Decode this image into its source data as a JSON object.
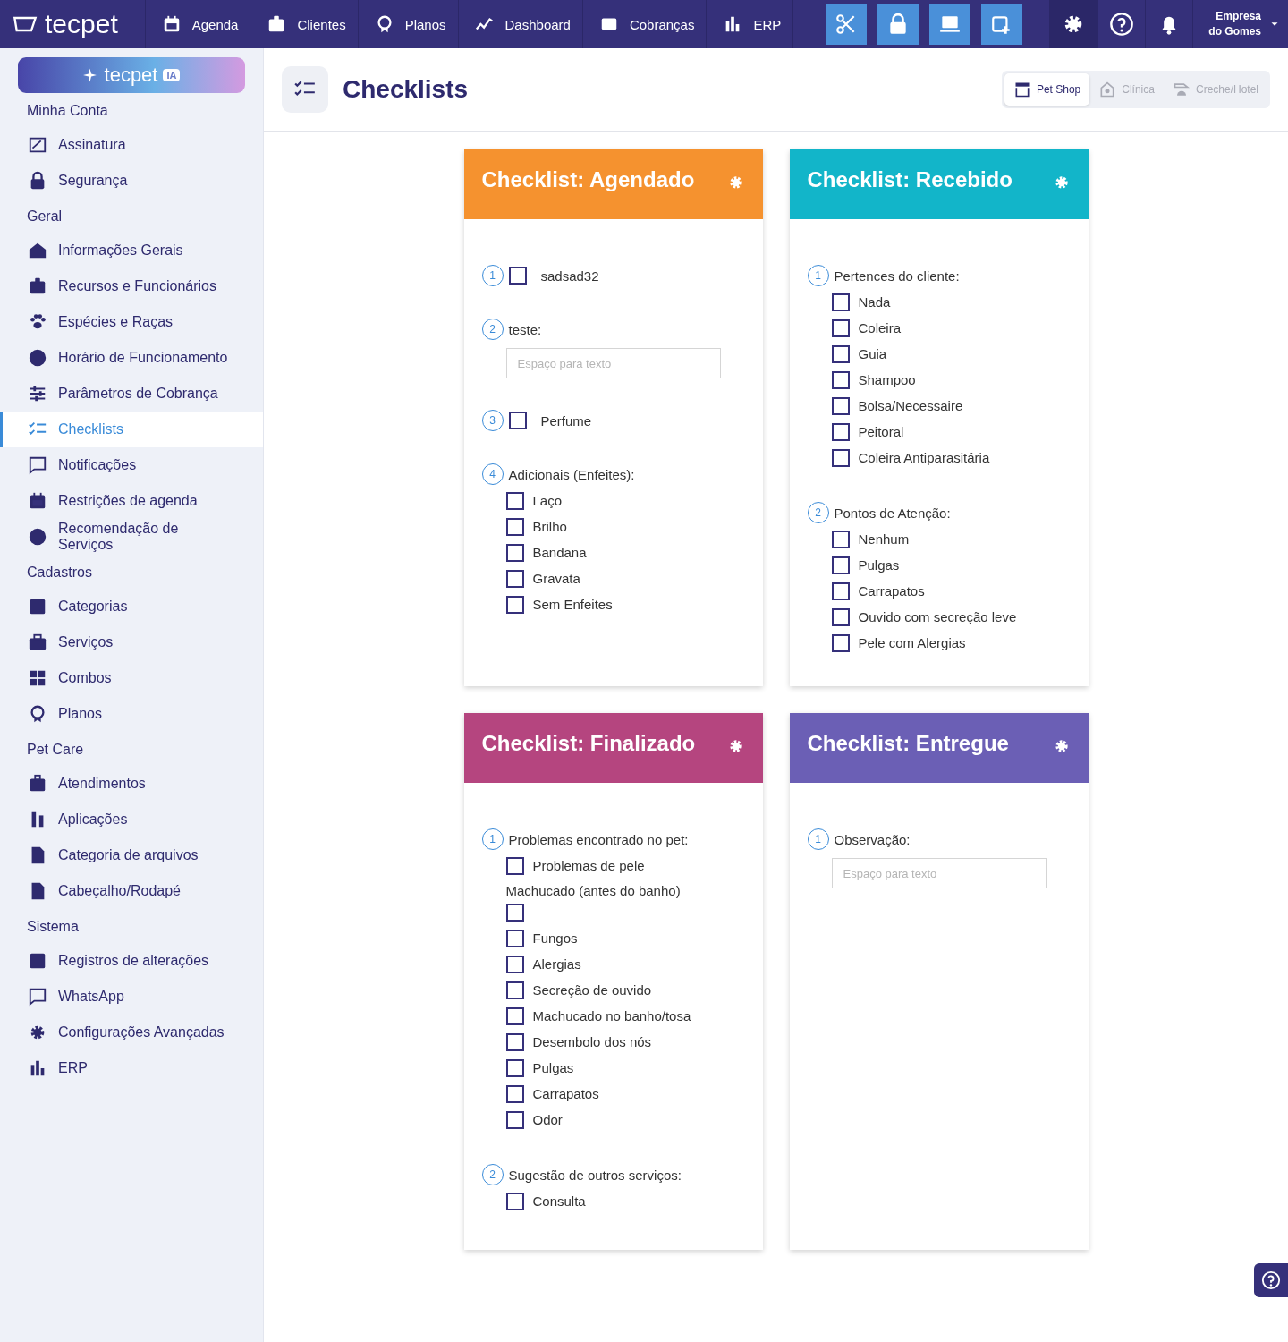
{
  "topbar": {
    "logo": "tecpet",
    "nav": [
      {
        "label": "Agenda"
      },
      {
        "label": "Clientes"
      },
      {
        "label": "Planos"
      },
      {
        "label": "Dashboard"
      },
      {
        "label": "Cobranças"
      },
      {
        "label": "ERP"
      }
    ],
    "company": "Empresa do Gomes"
  },
  "sidebar": {
    "ai_banner": {
      "logo": "tecpet",
      "badge": "IA"
    },
    "sections": [
      {
        "title": "Minha Conta",
        "items": [
          {
            "label": "Assinatura",
            "selected": false
          },
          {
            "label": "Segurança",
            "selected": false
          }
        ]
      },
      {
        "title": "Geral",
        "items": [
          {
            "label": "Informações Gerais",
            "selected": false
          },
          {
            "label": "Recursos e Funcionários",
            "selected": false
          },
          {
            "label": "Espécies e Raças",
            "selected": false
          },
          {
            "label": "Horário de Funcionamento",
            "selected": false
          },
          {
            "label": "Parâmetros de Cobrança",
            "selected": false
          },
          {
            "label": "Checklists",
            "selected": true
          },
          {
            "label": "Notificações",
            "selected": false
          },
          {
            "label": "Restrições de agenda",
            "selected": false
          },
          {
            "label": "Recomendação de Serviços",
            "selected": false
          }
        ]
      },
      {
        "title": "Cadastros",
        "items": [
          {
            "label": "Categorias",
            "selected": false
          },
          {
            "label": "Serviços",
            "selected": false
          },
          {
            "label": "Combos",
            "selected": false
          },
          {
            "label": "Planos",
            "selected": false
          }
        ]
      },
      {
        "title": "Pet Care",
        "items": [
          {
            "label": "Atendimentos",
            "selected": false
          },
          {
            "label": "Aplicações",
            "selected": false
          },
          {
            "label": "Categoria de arquivos",
            "selected": false
          },
          {
            "label": "Cabeçalho/Rodapé",
            "selected": false
          }
        ]
      },
      {
        "title": "Sistema",
        "items": [
          {
            "label": "Registros de alterações",
            "selected": false
          },
          {
            "label": "WhatsApp",
            "selected": false
          },
          {
            "label": "Configurações Avançadas",
            "selected": false
          },
          {
            "label": "ERP",
            "selected": false
          }
        ]
      }
    ]
  },
  "header": {
    "title": "Checklists",
    "segments": [
      {
        "label": "Pet Shop",
        "selected": true
      },
      {
        "label": "Clínica",
        "selected": false
      },
      {
        "label": "Creche/Hotel",
        "selected": false
      }
    ]
  },
  "checklists": [
    {
      "title": "Checklist: Agendado",
      "color": "#f5922f",
      "questions": [
        {
          "number": "1",
          "kind": "check",
          "label": "sadsad32",
          "checked": false
        },
        {
          "number": "2",
          "kind": "text",
          "label": "teste:",
          "placeholder": "Espaço para texto"
        },
        {
          "number": "3",
          "kind": "check",
          "label": "Perfume",
          "checked": false
        },
        {
          "number": "4",
          "kind": "options",
          "label": "Adicionais (Enfeites):",
          "options": [
            {
              "label": "Laço",
              "checked": false,
              "kind": "inline"
            },
            {
              "label": "Brilho",
              "checked": false,
              "kind": "inline"
            },
            {
              "label": "Bandana",
              "checked": false,
              "kind": "inline"
            },
            {
              "label": "Gravata",
              "checked": false,
              "kind": "inline"
            },
            {
              "label": "Sem Enfeites",
              "checked": false,
              "kind": "inline"
            }
          ]
        }
      ]
    },
    {
      "title": "Checklist: Recebido",
      "color": "#12b5c9",
      "questions": [
        {
          "number": "1",
          "kind": "options",
          "label": "Pertences do cliente:",
          "options": [
            {
              "label": "Nada",
              "checked": false,
              "kind": "inline"
            },
            {
              "label": "Coleira",
              "checked": false,
              "kind": "inline"
            },
            {
              "label": "Guia",
              "checked": false,
              "kind": "inline"
            },
            {
              "label": "Shampoo",
              "checked": false,
              "kind": "inline"
            },
            {
              "label": "Bolsa/Necessaire",
              "checked": false,
              "kind": "inline"
            },
            {
              "label": "Peitoral",
              "checked": false,
              "kind": "inline"
            },
            {
              "label": "Coleira Antiparasitária",
              "checked": false,
              "kind": "inline"
            }
          ]
        },
        {
          "number": "2",
          "kind": "options",
          "label": "Pontos de Atenção:",
          "options": [
            {
              "label": "Nenhum",
              "checked": false,
              "kind": "inline"
            },
            {
              "label": "Pulgas",
              "checked": false,
              "kind": "inline"
            },
            {
              "label": "Carrapatos",
              "checked": false,
              "kind": "inline"
            },
            {
              "label": "Ouvido com secreção leve",
              "checked": false,
              "kind": "inline"
            },
            {
              "label": "Pele com Alergias",
              "checked": false,
              "kind": "inline"
            }
          ]
        }
      ]
    },
    {
      "title": "Checklist: Finalizado",
      "color": "#b5457f",
      "questions": [
        {
          "number": "1",
          "kind": "options",
          "label": "Problemas encontrado no pet:",
          "options": [
            {
              "label": "Problemas de pele",
              "checked": false,
              "kind": "inline"
            },
            {
              "label": "Machucado (antes do banho)",
              "checked": false,
              "kind": "stacked"
            },
            {
              "label": "Fungos",
              "checked": false,
              "kind": "inline"
            },
            {
              "label": "Alergias",
              "checked": false,
              "kind": "inline"
            },
            {
              "label": "Secreção de ouvido",
              "checked": false,
              "kind": "inline"
            },
            {
              "label": "Machucado no banho/tosa",
              "checked": false,
              "kind": "inline"
            },
            {
              "label": "Desembolo dos nós",
              "checked": false,
              "kind": "inline"
            },
            {
              "label": "Pulgas",
              "checked": false,
              "kind": "inline"
            },
            {
              "label": "Carrapatos",
              "checked": false,
              "kind": "inline"
            },
            {
              "label": "Odor",
              "checked": false,
              "kind": "inline"
            }
          ]
        },
        {
          "number": "2",
          "kind": "options",
          "label": "Sugestão de outros serviços:",
          "options": [
            {
              "label": "Consulta",
              "checked": false,
              "kind": "inline"
            }
          ]
        }
      ]
    },
    {
      "title": "Checklist: Entregue",
      "color": "#6b5fb5",
      "questions": [
        {
          "number": "1",
          "kind": "text",
          "label": "Observação:",
          "placeholder": "Espaço para texto"
        }
      ]
    }
  ]
}
